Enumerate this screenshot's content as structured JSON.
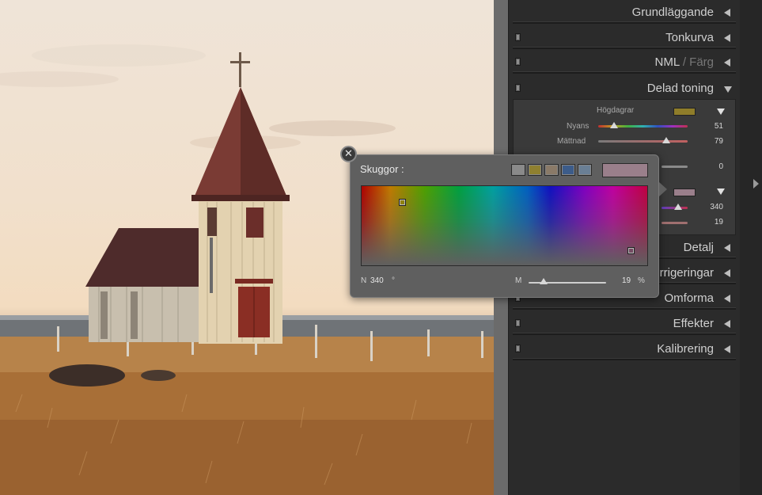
{
  "panel": {
    "sections": [
      {
        "label": "Grundläggande"
      },
      {
        "label": "Tonkurva"
      },
      {
        "label_main": "NML",
        "label_sep": "/",
        "label_dim": "Färg"
      },
      {
        "label": "Delad toning"
      },
      {
        "label": "Detalj"
      },
      {
        "label_visible": "rrigeringar"
      },
      {
        "label": "Omforma"
      },
      {
        "label": "Effekter"
      },
      {
        "label": "Kalibrering"
      }
    ],
    "split_toning": {
      "highlights_label": "Högdagrar",
      "highlights_color": "#8f7d2a",
      "hue_label": "Nyans",
      "hue_value": "51",
      "saturation_label": "Mättnad",
      "saturation_value": "79",
      "balance_value": "0",
      "shadows_color": "#9a7f8b",
      "shadows_hue_value": "340",
      "shadows_saturation_value": "19"
    }
  },
  "popup": {
    "title": "Skuggor :",
    "close_glyph": "✕",
    "presets": [
      "#8a8a8a",
      "#8f8030",
      "#8a7a68",
      "#3c5c8a",
      "#6a7f95"
    ],
    "current_color": "#9a7f8b",
    "hue_label": "N",
    "hue_value": "340",
    "hue_unit": "°",
    "sat_label": "M",
    "sat_value": "19",
    "sat_unit": "%",
    "sat_fraction": 0.19
  }
}
